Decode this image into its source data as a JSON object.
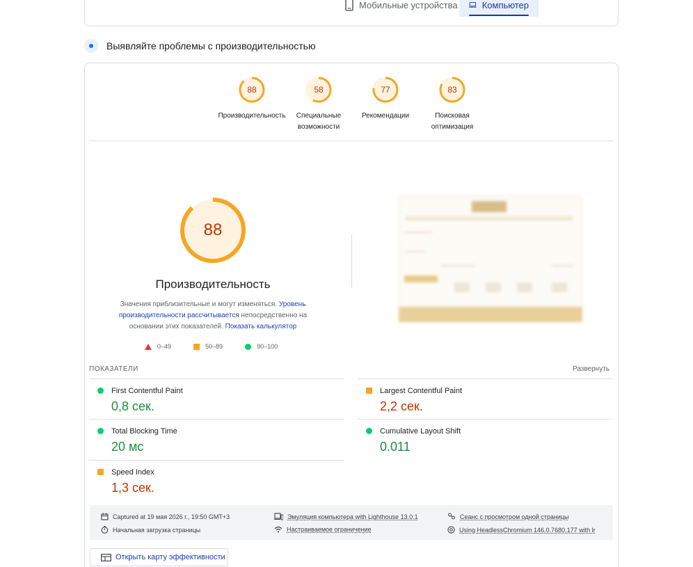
{
  "tabs": {
    "mobile_label": "Мобильные устройства",
    "desktop_label": "Компьютер"
  },
  "section": {
    "title": "Выявляйте проблемы с производительностью"
  },
  "categories": [
    {
      "score": "88",
      "label_line1": "Производительность",
      "label_line2": ""
    },
    {
      "score": "58",
      "label_line1": "Специальные",
      "label_line2": "возможности"
    },
    {
      "score": "77",
      "label_line1": "Рекомендации",
      "label_line2": ""
    },
    {
      "score": "83",
      "label_line1": "Поисковая",
      "label_line2": "оптимизация"
    }
  ],
  "performance": {
    "score": "88",
    "title": "Производительность",
    "desc_text1": "Значения приблизительные и могут изменяться. ",
    "desc_link1": "Уровень производительности рассчитывается",
    "desc_text2": " непосредственно на основании этих показателей. ",
    "desc_link2": "Показать калькулятор"
  },
  "legend": {
    "poor": "0–49",
    "average": "50–89",
    "good": "90–100"
  },
  "metrics": {
    "header": "ПОКАЗАТЕЛИ",
    "expand_label": "Развернуть",
    "fcp": {
      "name": "First Contentful Paint",
      "value": "0,8 сек."
    },
    "lcp": {
      "name": "Largest Contentful Paint",
      "value": "2,2 сек."
    },
    "tbt": {
      "name": "Total Blocking Time",
      "value": "20 мс"
    },
    "cls": {
      "name": "Cumulative Layout Shift",
      "value": "0.011"
    },
    "si": {
      "name": "Speed Index",
      "value": "1,3 сек."
    }
  },
  "info": {
    "captured": "Captured at 19 мая 2026 г., 19:50 GMT+3",
    "initial_load": "Начальная загрузка страницы",
    "emulation": "Эмуляция компьютера with Lighthouse 13.0.1",
    "throttling": "Настраиваемое ограничение",
    "session": "Сеанс с просмотром одной страницы",
    "browser": "Using HeadlessChromium 146.0.7680.177 with lr"
  },
  "treemap_button": "Открыть карту эффективности",
  "colors": {
    "average": "#f5a623",
    "good": "#0cce6b",
    "poor": "#e53935",
    "accent": "#1a3a8f"
  }
}
